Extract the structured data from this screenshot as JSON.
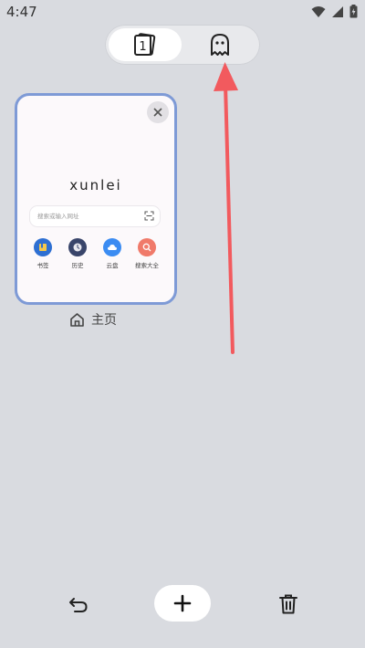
{
  "status_bar": {
    "time": "4:47",
    "icons": [
      "wifi-icon",
      "signal-icon",
      "battery-icon"
    ]
  },
  "mode_switch": {
    "tab_count": "1",
    "normal_icon": "tab-count-icon",
    "incognito_icon": "ghost-icon"
  },
  "tab_card": {
    "logo_text": "xunlei",
    "search_placeholder": "搜索或输入网址",
    "quick_links": [
      {
        "label": "书签",
        "icon": "bookmark-icon",
        "color": "#2d6fd2"
      },
      {
        "label": "历史",
        "icon": "history-icon",
        "color": "#39456a"
      },
      {
        "label": "云盘",
        "icon": "cloud-icon",
        "color": "#3b8cf2"
      },
      {
        "label": "搜索大全",
        "icon": "search-all-icon",
        "color": "#f07a6a"
      }
    ],
    "border_color": "#7e9ad6"
  },
  "tab_title": "主页",
  "annotation_color": "#f25a5e",
  "bottom_bar": {
    "icons": [
      "undo-icon",
      "plus-icon",
      "trash-icon"
    ]
  }
}
